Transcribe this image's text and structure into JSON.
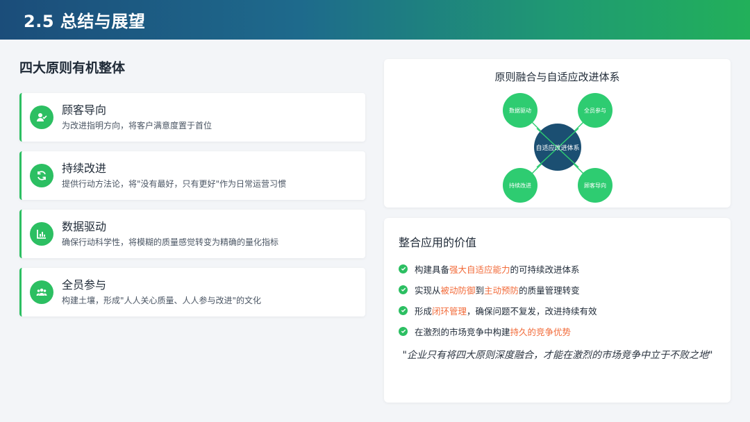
{
  "header": {
    "title": "2.5 总结与展望"
  },
  "left": {
    "section_title": "四大原则有机整体",
    "cards": [
      {
        "name": "顾客导向",
        "desc": "为改进指明方向，将客户满意度置于首位",
        "icon": "user-check-icon"
      },
      {
        "name": "持续改进",
        "desc": "提供行动方法论，将\"没有最好，只有更好\"作为日常运营习惯",
        "icon": "refresh-icon"
      },
      {
        "name": "数据驱动",
        "desc": "确保行动科学性，将模糊的质量感觉转变为精确的量化指标",
        "icon": "chart-icon"
      },
      {
        "name": "全员参与",
        "desc": "构建土壤，形成\"人人关心质量、人人参与改进\"的文化",
        "icon": "users-icon"
      }
    ]
  },
  "diagram": {
    "title": "原则融合与自适应改进体系",
    "center": "自适应改进体系",
    "nodes": {
      "top_left": "数据驱动",
      "top_right": "全员参与",
      "bottom_left": "持续改进",
      "bottom_right": "顾客导向"
    },
    "colors": {
      "node": "#2ecc71",
      "center": "#1b4f72",
      "line": "#2ecc71"
    }
  },
  "value": {
    "title": "整合应用的价值",
    "items": [
      {
        "pre": "构建具备",
        "hl": "强大自适应能力",
        "post": "的可持续改进体系"
      },
      {
        "pre": "实现从",
        "hl": "被动防御",
        "mid": "到",
        "hl2": "主动预防",
        "post": "的质量管理转变"
      },
      {
        "pre": "形成",
        "hl": "闭环管理",
        "post": "，确保问题不复发，改进持续有效"
      },
      {
        "pre": "在激烈的市场竞争中构建",
        "hl": "持久的竞争优势",
        "post": ""
      }
    ],
    "quote": "\"企业只有将四大原则深度融合，才能在激烈的市场竞争中立于不败之地\""
  },
  "colors": {
    "accent": "#2cbf62",
    "highlight": "#f26b3a",
    "header_start": "#1b4d7a",
    "header_end": "#22b05a"
  }
}
